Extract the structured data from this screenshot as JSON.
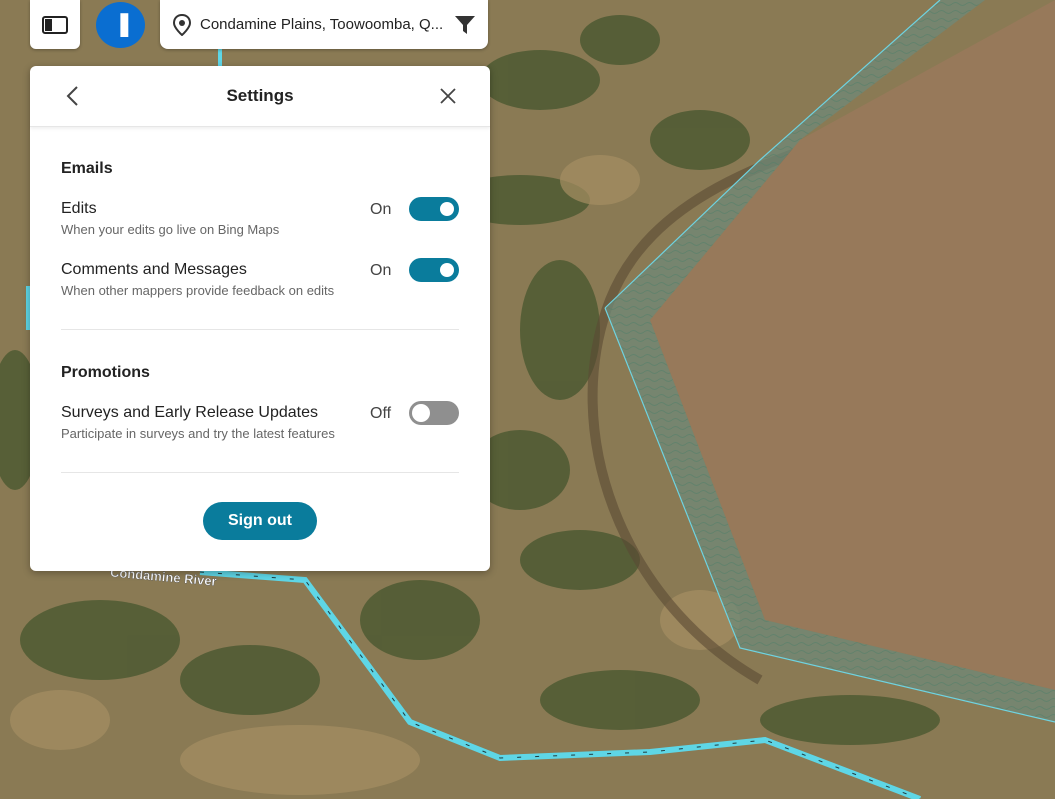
{
  "topbar": {
    "search_text": "Condamine Plains, Toowoomba, Q...",
    "profile_glyph": "▐"
  },
  "map": {
    "river_label": "Condamine River"
  },
  "settings": {
    "title": "Settings",
    "emails": {
      "heading": "Emails",
      "items": [
        {
          "label": "Edits",
          "desc": "When your edits go live on Bing Maps",
          "state": "On"
        },
        {
          "label": "Comments and Messages",
          "desc": "When other mappers provide feedback on edits",
          "state": "On"
        }
      ]
    },
    "promotions": {
      "heading": "Promotions",
      "items": [
        {
          "label": "Surveys and Early Release Updates",
          "desc": "Participate in surveys and try the latest features",
          "state": "Off"
        }
      ]
    },
    "signout_label": "Sign out"
  },
  "colors": {
    "accent": "#0a7c9c",
    "profile": "#0a6ed1",
    "toggle_off": "#8f8f8f"
  }
}
